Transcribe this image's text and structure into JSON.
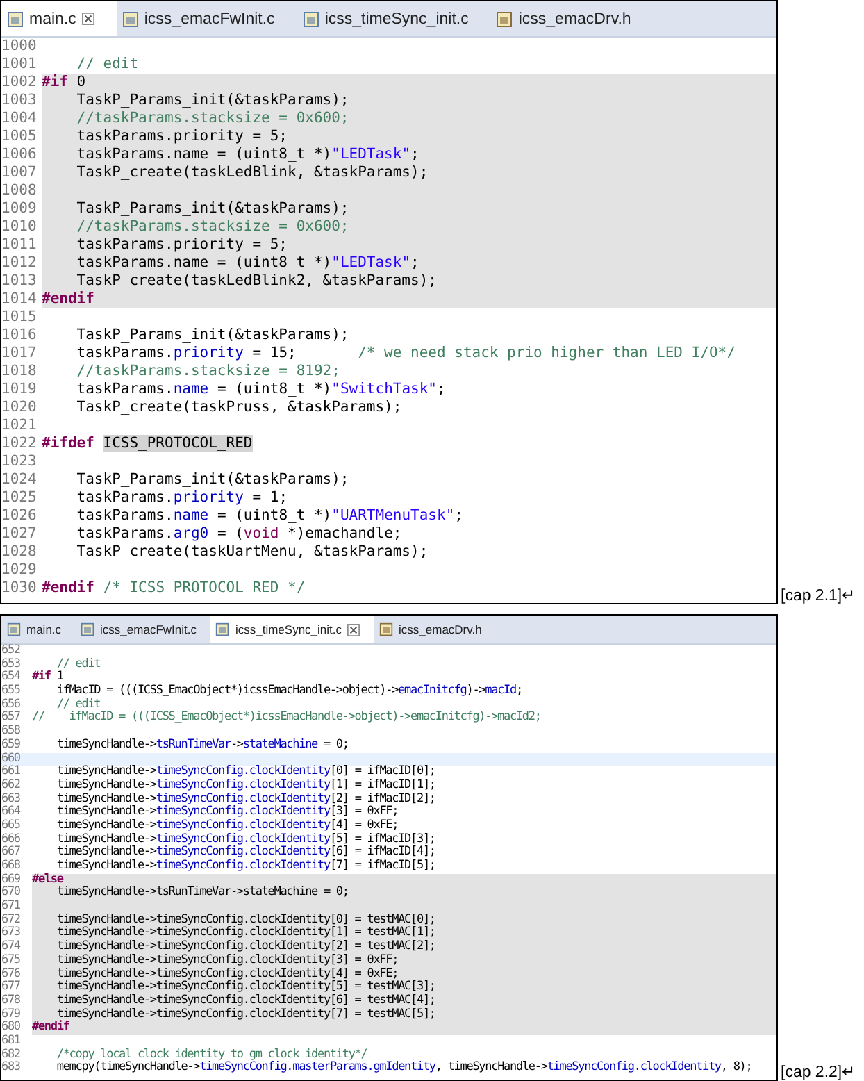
{
  "figures": [
    {
      "tabs": [
        {
          "label": "main.c",
          "kind": "c-file",
          "selected": true
        },
        {
          "label": "icss_emacFwInit.c",
          "kind": "c-file",
          "selected": false
        },
        {
          "label": "icss_timeSync_init.c",
          "kind": "c-file",
          "selected": false
        },
        {
          "label": "icss_emacDrv.h",
          "kind": "h-file",
          "selected": false
        }
      ],
      "lines": [
        {
          "number": "1000",
          "kind": "normal"
        },
        {
          "number": "1001",
          "kind": "normal",
          "code": [
            {
              "kind": "comment",
              "text": "    // edit"
            }
          ]
        },
        {
          "number": "1002",
          "kind": "inactive",
          "code": [
            {
              "kind": "directive",
              "text": "#if"
            },
            {
              "kind": "plain",
              "text": " 0"
            }
          ]
        },
        {
          "number": "1003",
          "kind": "inactive",
          "code": [
            {
              "kind": "plain",
              "text": "    TaskP_Params_init(&taskParams);"
            }
          ]
        },
        {
          "number": "1004",
          "kind": "inactive",
          "code": [
            {
              "kind": "comment",
              "text": "    //taskParams.stacksize = 0x600;"
            }
          ]
        },
        {
          "number": "1005",
          "kind": "inactive",
          "code": [
            {
              "kind": "plain",
              "text": "    taskParams.priority = 5;"
            }
          ]
        },
        {
          "number": "1006",
          "kind": "inactive",
          "code": [
            {
              "kind": "plain",
              "text": "    taskParams.name = (uint8_t *)"
            },
            {
              "kind": "string",
              "text": "\"LEDTask\""
            },
            {
              "kind": "plain",
              "text": ";"
            }
          ]
        },
        {
          "number": "1007",
          "kind": "inactive",
          "code": [
            {
              "kind": "plain",
              "text": "    TaskP_create(taskLedBlink, &taskParams);"
            }
          ]
        },
        {
          "number": "1008",
          "kind": "inactive"
        },
        {
          "number": "1009",
          "kind": "inactive",
          "code": [
            {
              "kind": "plain",
              "text": "    TaskP_Params_init(&taskParams);"
            }
          ]
        },
        {
          "number": "1010",
          "kind": "inactive",
          "code": [
            {
              "kind": "comment",
              "text": "    //taskParams.stacksize = 0x600;"
            }
          ]
        },
        {
          "number": "1011",
          "kind": "inactive",
          "code": [
            {
              "kind": "plain",
              "text": "    taskParams.priority = 5;"
            }
          ]
        },
        {
          "number": "1012",
          "kind": "inactive",
          "code": [
            {
              "kind": "plain",
              "text": "    taskParams.name = (uint8_t *)"
            },
            {
              "kind": "string",
              "text": "\"LEDTask\""
            },
            {
              "kind": "plain",
              "text": ";"
            }
          ]
        },
        {
          "number": "1013",
          "kind": "inactive",
          "code": [
            {
              "kind": "plain",
              "text": "    TaskP_create(taskLedBlink2, &taskParams);"
            }
          ]
        },
        {
          "number": "1014",
          "kind": "inactive",
          "code": [
            {
              "kind": "directive",
              "text": "#endif"
            }
          ]
        },
        {
          "number": "1015",
          "kind": "normal"
        },
        {
          "number": "1016",
          "kind": "normal",
          "code": [
            {
              "kind": "plain",
              "text": "    TaskP_Params_init(&taskParams);"
            }
          ]
        },
        {
          "number": "1017",
          "kind": "normal",
          "code": [
            {
              "kind": "plain",
              "text": "    taskParams."
            },
            {
              "kind": "field",
              "text": "priority"
            },
            {
              "kind": "plain",
              "text": " = 15;       "
            },
            {
              "kind": "comment",
              "text": "/* we need stack prio higher than LED I/O*/"
            }
          ]
        },
        {
          "number": "1018",
          "kind": "normal",
          "code": [
            {
              "kind": "comment",
              "text": "    //taskParams.stacksize = 8192;"
            }
          ]
        },
        {
          "number": "1019",
          "kind": "normal",
          "code": [
            {
              "kind": "plain",
              "text": "    taskParams."
            },
            {
              "kind": "field",
              "text": "name"
            },
            {
              "kind": "plain",
              "text": " = (uint8_t *)"
            },
            {
              "kind": "string",
              "text": "\"SwitchTask\""
            },
            {
              "kind": "plain",
              "text": ";"
            }
          ]
        },
        {
          "number": "1020",
          "kind": "normal",
          "code": [
            {
              "kind": "plain",
              "text": "    TaskP_create(taskPruss, &taskParams);"
            }
          ]
        },
        {
          "number": "1021",
          "kind": "normal"
        },
        {
          "number": "1022",
          "kind": "normal",
          "code": [
            {
              "kind": "directive",
              "text": "#ifdef"
            },
            {
              "kind": "occurrence",
              "text": "ICSS_PROTOCOL_RED"
            }
          ]
        },
        {
          "number": "1023",
          "kind": "normal"
        },
        {
          "number": "1024",
          "kind": "normal",
          "code": [
            {
              "kind": "plain",
              "text": "    TaskP_Params_init(&taskParams);"
            }
          ]
        },
        {
          "number": "1025",
          "kind": "normal",
          "code": [
            {
              "kind": "plain",
              "text": "    taskParams."
            },
            {
              "kind": "field",
              "text": "priority"
            },
            {
              "kind": "plain",
              "text": " = 1;"
            }
          ]
        },
        {
          "number": "1026",
          "kind": "normal",
          "code": [
            {
              "kind": "plain",
              "text": "    taskParams."
            },
            {
              "kind": "field",
              "text": "name"
            },
            {
              "kind": "plain",
              "text": " = (uint8_t *)"
            },
            {
              "kind": "string",
              "text": "\"UARTMenuTask\""
            },
            {
              "kind": "plain",
              "text": ";"
            }
          ]
        },
        {
          "number": "1027",
          "kind": "normal",
          "code": [
            {
              "kind": "plain",
              "text": "    taskParams."
            },
            {
              "kind": "field",
              "text": "arg0"
            },
            {
              "kind": "plain",
              "text": " = ("
            },
            {
              "kind": "keyword",
              "text": "void"
            },
            {
              "kind": "plain",
              "text": " *)emachandle;"
            }
          ]
        },
        {
          "number": "1028",
          "kind": "normal",
          "code": [
            {
              "kind": "plain",
              "text": "    TaskP_create(taskUartMenu, &taskParams);"
            }
          ]
        },
        {
          "number": "1029",
          "kind": "normal"
        },
        {
          "number": "1030",
          "kind": "normal",
          "code": [
            {
              "kind": "directive",
              "text": "#endif"
            },
            {
              "kind": "comment",
              "text": " /* ICSS_PROTOCOL_RED */"
            }
          ]
        }
      ],
      "caption": "[cap 2.1]↵"
    },
    {
      "tabs": [
        {
          "label": "main.c",
          "kind": "c-file",
          "selected": false
        },
        {
          "label": "icss_emacFwInit.c",
          "kind": "c-file",
          "selected": false
        },
        {
          "label": "icss_timeSync_init.c",
          "kind": "c-file",
          "selected": true
        },
        {
          "label": "icss_emacDrv.h",
          "kind": "h-file",
          "selected": false
        }
      ],
      "lines": [
        {
          "number": "652",
          "kind": "normal"
        },
        {
          "number": "653",
          "kind": "normal",
          "code": [
            {
              "kind": "comment",
              "text": "    // edit"
            }
          ]
        },
        {
          "number": "654",
          "kind": "normal",
          "code": [
            {
              "kind": "directive",
              "text": "#if"
            },
            {
              "kind": "plain",
              "text": " 1"
            }
          ]
        },
        {
          "number": "655",
          "kind": "normal",
          "code": [
            {
              "kind": "plain",
              "text": "    ifMacID = (((ICSS_EmacObject*)icssEmacHandle->object)->"
            },
            {
              "kind": "field",
              "text": "emacInitcfg"
            },
            {
              "kind": "plain",
              "text": ")->"
            },
            {
              "kind": "field",
              "text": "macId"
            },
            {
              "kind": "plain",
              "text": ";"
            }
          ]
        },
        {
          "number": "656",
          "kind": "normal",
          "code": [
            {
              "kind": "comment",
              "text": "    // edit"
            }
          ]
        },
        {
          "number": "657",
          "kind": "normal",
          "code": [
            {
              "kind": "comment",
              "text": "//    ifMacID = (((ICSS_EmacObject*)icssEmacHandle->object)->emacInitcfg)->macId2;"
            }
          ]
        },
        {
          "number": "658",
          "kind": "normal"
        },
        {
          "number": "659",
          "kind": "normal",
          "code": [
            {
              "kind": "plain",
              "text": "    timeSyncHandle->"
            },
            {
              "kind": "field",
              "text": "tsRunTimeVar"
            },
            {
              "kind": "plain",
              "text": "->"
            },
            {
              "kind": "field",
              "text": "stateMachine"
            },
            {
              "kind": "plain",
              "text": " = 0;"
            }
          ]
        },
        {
          "number": "660",
          "kind": "current"
        },
        {
          "number": "661",
          "kind": "normal",
          "code": [
            {
              "kind": "plain",
              "text": "    timeSyncHandle->"
            },
            {
              "kind": "field",
              "text": "timeSyncConfig.clockIdentity"
            },
            {
              "kind": "plain",
              "text": "[0] = ifMacID[0];"
            }
          ]
        },
        {
          "number": "662",
          "kind": "normal",
          "code": [
            {
              "kind": "plain",
              "text": "    timeSyncHandle->"
            },
            {
              "kind": "field",
              "text": "timeSyncConfig.clockIdentity"
            },
            {
              "kind": "plain",
              "text": "[1] = ifMacID[1];"
            }
          ]
        },
        {
          "number": "663",
          "kind": "normal",
          "code": [
            {
              "kind": "plain",
              "text": "    timeSyncHandle->"
            },
            {
              "kind": "field",
              "text": "timeSyncConfig.clockIdentity"
            },
            {
              "kind": "plain",
              "text": "[2] = ifMacID[2];"
            }
          ]
        },
        {
          "number": "664",
          "kind": "normal",
          "code": [
            {
              "kind": "plain",
              "text": "    timeSyncHandle->"
            },
            {
              "kind": "field",
              "text": "timeSyncConfig.clockIdentity"
            },
            {
              "kind": "plain",
              "text": "[3] = 0xFF;"
            }
          ]
        },
        {
          "number": "665",
          "kind": "normal",
          "code": [
            {
              "kind": "plain",
              "text": "    timeSyncHandle->"
            },
            {
              "kind": "field",
              "text": "timeSyncConfig.clockIdentity"
            },
            {
              "kind": "plain",
              "text": "[4] = 0xFE;"
            }
          ]
        },
        {
          "number": "666",
          "kind": "normal",
          "code": [
            {
              "kind": "plain",
              "text": "    timeSyncHandle->"
            },
            {
              "kind": "field",
              "text": "timeSyncConfig.clockIdentity"
            },
            {
              "kind": "plain",
              "text": "[5] = ifMacID[3];"
            }
          ]
        },
        {
          "number": "667",
          "kind": "normal",
          "code": [
            {
              "kind": "plain",
              "text": "    timeSyncHandle->"
            },
            {
              "kind": "field",
              "text": "timeSyncConfig.clockIdentity"
            },
            {
              "kind": "plain",
              "text": "[6] = ifMacID[4];"
            }
          ]
        },
        {
          "number": "668",
          "kind": "normal",
          "code": [
            {
              "kind": "plain",
              "text": "    timeSyncHandle->"
            },
            {
              "kind": "field",
              "text": "timeSyncConfig.clockIdentity"
            },
            {
              "kind": "plain",
              "text": "[7] = ifMacID[5];"
            }
          ]
        },
        {
          "number": "669",
          "kind": "inactive",
          "code": [
            {
              "kind": "directive",
              "text": "#else"
            }
          ]
        },
        {
          "number": "670",
          "kind": "inactive",
          "code": [
            {
              "kind": "plain",
              "text": "    timeSyncHandle->tsRunTimeVar->stateMachine = 0;"
            }
          ]
        },
        {
          "number": "671",
          "kind": "inactive"
        },
        {
          "number": "672",
          "kind": "inactive",
          "code": [
            {
              "kind": "plain",
              "text": "    timeSyncHandle->timeSyncConfig.clockIdentity[0] = testMAC[0];"
            }
          ]
        },
        {
          "number": "673",
          "kind": "inactive",
          "code": [
            {
              "kind": "plain",
              "text": "    timeSyncHandle->timeSyncConfig.clockIdentity[1] = testMAC[1];"
            }
          ]
        },
        {
          "number": "674",
          "kind": "inactive",
          "code": [
            {
              "kind": "plain",
              "text": "    timeSyncHandle->timeSyncConfig.clockIdentity[2] = testMAC[2];"
            }
          ]
        },
        {
          "number": "675",
          "kind": "inactive",
          "code": [
            {
              "kind": "plain",
              "text": "    timeSyncHandle->timeSyncConfig.clockIdentity[3] = 0xFF;"
            }
          ]
        },
        {
          "number": "676",
          "kind": "inactive",
          "code": [
            {
              "kind": "plain",
              "text": "    timeSyncHandle->timeSyncConfig.clockIdentity[4] = 0xFE;"
            }
          ]
        },
        {
          "number": "677",
          "kind": "inactive",
          "code": [
            {
              "kind": "plain",
              "text": "    timeSyncHandle->timeSyncConfig.clockIdentity[5] = testMAC[3];"
            }
          ]
        },
        {
          "number": "678",
          "kind": "inactive",
          "code": [
            {
              "kind": "plain",
              "text": "    timeSyncHandle->timeSyncConfig.clockIdentity[6] = testMAC[4];"
            }
          ]
        },
        {
          "number": "679",
          "kind": "inactive",
          "code": [
            {
              "kind": "plain",
              "text": "    timeSyncHandle->timeSyncConfig.clockIdentity[7] = testMAC[5];"
            }
          ]
        },
        {
          "number": "680",
          "kind": "inactive",
          "code": [
            {
              "kind": "directive",
              "text": "#endif"
            }
          ]
        },
        {
          "number": "681",
          "kind": "normal"
        },
        {
          "number": "682",
          "kind": "normal",
          "code": [
            {
              "kind": "comment",
              "text": "    /*copy local clock identity to gm clock identity*/"
            }
          ]
        },
        {
          "number": "683",
          "kind": "normal",
          "code": [
            {
              "kind": "plain",
              "text": "    memcpy(timeSyncHandle->"
            },
            {
              "kind": "field",
              "text": "timeSyncConfig.masterParams.gmIdentity"
            },
            {
              "kind": "plain",
              "text": ", timeSyncHandle->"
            },
            {
              "kind": "field",
              "text": "timeSyncConfig.clockIdentity"
            },
            {
              "kind": "plain",
              "text": ", 8);"
            }
          ]
        }
      ],
      "caption": "[cap 2.2]↵"
    }
  ]
}
